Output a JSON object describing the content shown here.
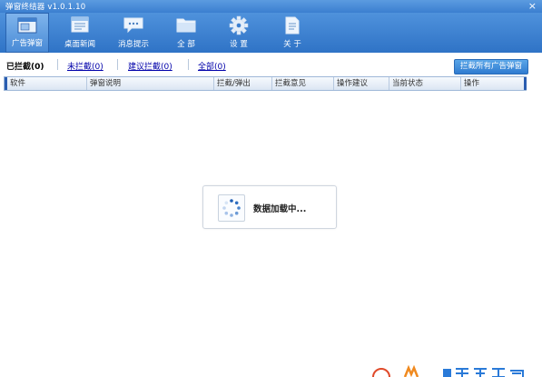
{
  "app": {
    "title": "弹窗终结器 v1.0.1.10",
    "close_glyph": "×"
  },
  "toolbar": {
    "items": [
      {
        "label": "广告弹窗",
        "icon": "ad-window-icon",
        "active": true
      },
      {
        "label": "桌面新闻",
        "icon": "desktop-news-icon",
        "active": false
      },
      {
        "label": "消息提示",
        "icon": "message-bubble-icon",
        "active": false
      },
      {
        "label": "全 部",
        "icon": "folder-icon",
        "active": false
      },
      {
        "label": "设 置",
        "icon": "gear-icon",
        "active": false
      },
      {
        "label": "关 于",
        "icon": "document-icon",
        "active": false
      }
    ]
  },
  "filter_tabs": [
    {
      "label": "已拦截(0)",
      "current": true
    },
    {
      "label": "未拦截(0)",
      "current": false
    },
    {
      "label": "建议拦截(0)",
      "current": false
    },
    {
      "label": "全部(0)",
      "current": false
    }
  ],
  "block_all_button": "拦截所有广告弹窗",
  "table": {
    "columns": [
      "软件",
      "弹窗说明",
      "拦截/弹出",
      "拦截意见",
      "操作建议",
      "当前状态",
      "操作"
    ],
    "rows": []
  },
  "loading": {
    "text": "数据加载中..."
  },
  "colors": {
    "titlebar": "#3b7fd0",
    "toolbar": "#2f73c6",
    "link": "#0000aa",
    "accent": "#2a5db0"
  }
}
